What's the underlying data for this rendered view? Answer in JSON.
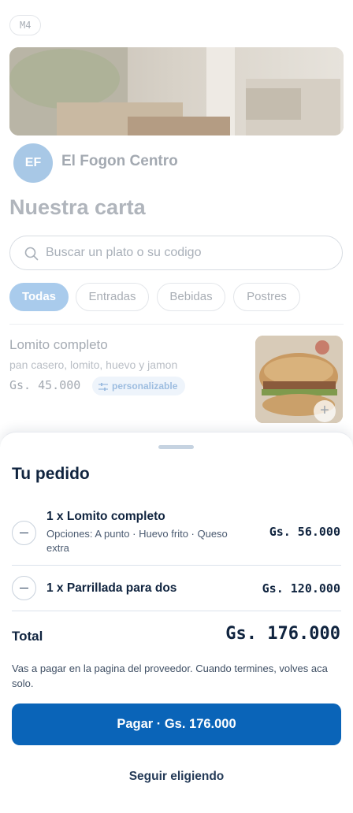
{
  "background": {
    "badge": "M4",
    "restaurant": {
      "initials": "EF",
      "name": "El Fogon Centro"
    },
    "menu_title": "Nuestra carta",
    "search": {
      "placeholder": "Buscar un plato o su codigo",
      "icon": "search-icon"
    },
    "categories": [
      {
        "label": "Todas",
        "active": true
      },
      {
        "label": "Entradas",
        "active": false
      },
      {
        "label": "Bebidas",
        "active": false
      },
      {
        "label": "Postres",
        "active": false
      }
    ],
    "dish": {
      "name": "Lomito completo",
      "description": "pan casero, lomito, huevo y jamon",
      "price": "Gs. 45.000",
      "tag": "personalizable",
      "add_label": "+"
    }
  },
  "order_sheet": {
    "title": "Tu pedido",
    "items": [
      {
        "name": "1 x Lomito completo",
        "options": "Opciones: A punto · Huevo frito · Queso extra",
        "price": "Gs. 56.000"
      },
      {
        "name": "1 x Parrillada para dos",
        "options": "",
        "price": "Gs. 120.000"
      }
    ],
    "total_label": "Total",
    "total_value": "Gs. 176.000",
    "note": "Vas a pagar en la pagina del proveedor. Cuando termines, volves aca solo.",
    "pay_button": "Pagar · Gs. 176.000",
    "keep_button": "Seguir eligiendo"
  },
  "colors": {
    "primary": "#0a64b8",
    "text": "#10243f",
    "chip_active": "#a9cbec"
  }
}
